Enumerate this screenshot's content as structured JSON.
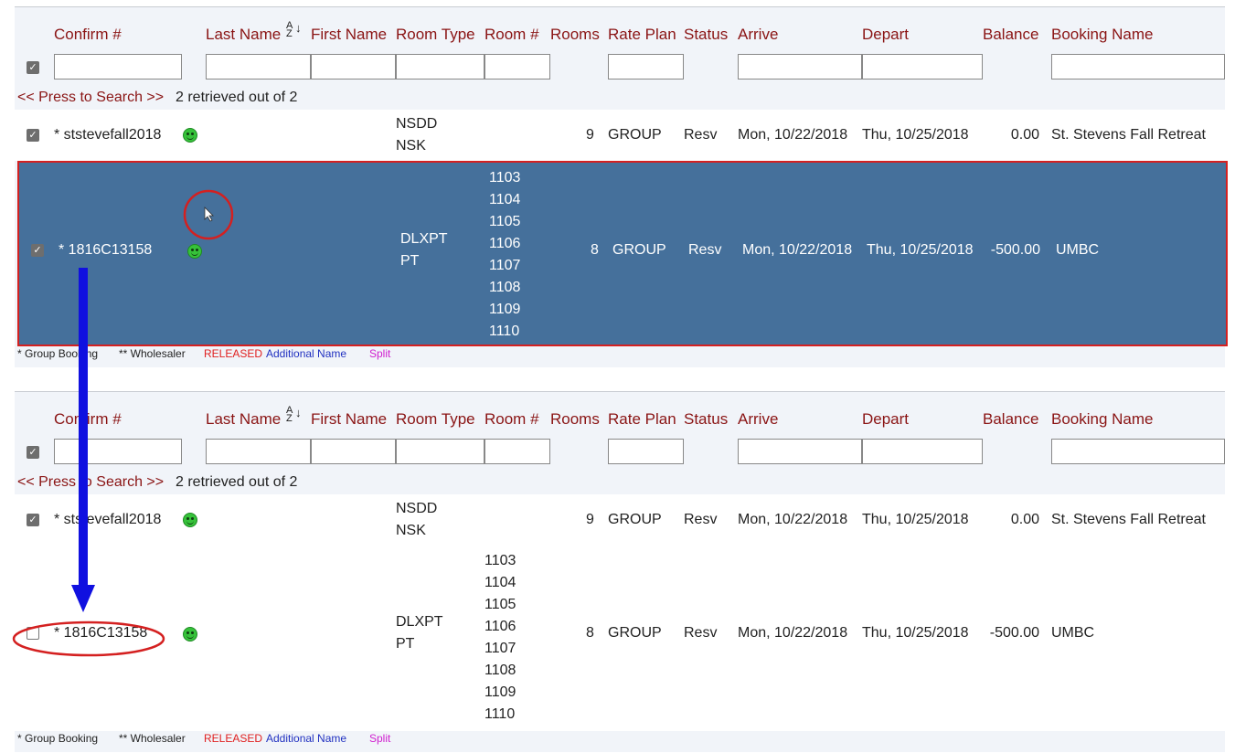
{
  "columns": {
    "confirm": "Confirm #",
    "last_name": "Last Name",
    "first_name": "First Name",
    "room_type": "Room Type",
    "room_num": "Room #",
    "rooms": "Rooms",
    "rate_plan": "Rate Plan",
    "status": "Status",
    "arrive": "Arrive",
    "depart": "Depart",
    "balance": "Balance",
    "booking_name": "Booking Name"
  },
  "search": {
    "press_label": "<< Press to Search >>",
    "retrieved": "2 retrieved out of 2"
  },
  "rows": [
    {
      "confirm": "* ststevefall2018",
      "room_type_1": "NSDD",
      "room_type_2": "NSK",
      "rooms_list": [],
      "rooms": "9",
      "rate_plan": "GROUP",
      "status": "Resv",
      "arrive": "Mon, 10/22/2018",
      "depart": "Thu, 10/25/2018",
      "balance": "0.00",
      "booking_name": "St. Stevens Fall Retreat"
    },
    {
      "confirm": "* 1816C13158",
      "room_type_1": "DLXPT",
      "room_type_2": "PT",
      "rooms_list": [
        "1103",
        "1104",
        "1105",
        "1106",
        "1107",
        "1108",
        "1109",
        "1110"
      ],
      "rooms": "8",
      "rate_plan": "GROUP",
      "status": "Resv",
      "arrive": "Mon, 10/22/2018",
      "depart": "Thu, 10/25/2018",
      "balance": "-500.00",
      "booking_name": "UMBC"
    }
  ],
  "legend": {
    "group": "* Group Booking",
    "wholesaler": "** Wholesaler",
    "released": "RELEASED",
    "additional": "Additional Name",
    "split": "Split"
  },
  "colors": {
    "header": "#8a1414",
    "selected_row": "#45709b",
    "highlight": "#d42020",
    "arrow": "#1010e0",
    "released": "#e02020",
    "additional": "#2030c0",
    "split": "#d020d0"
  },
  "panels": [
    {
      "id": "before",
      "row2_checked": true,
      "row2_selected": true
    },
    {
      "id": "after",
      "row2_checked": false,
      "row2_selected": false
    }
  ]
}
